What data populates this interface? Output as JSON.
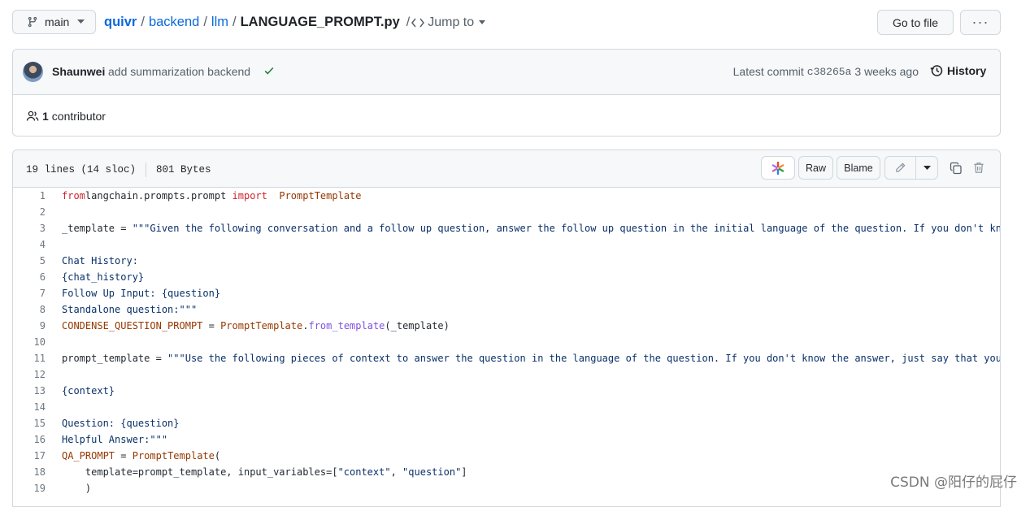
{
  "breadcrumb": {
    "branch": "main",
    "repo": "quivr",
    "dir1": "backend",
    "dir2": "llm",
    "file": "LANGUAGE_PROMPT.py",
    "jump": "Jump to"
  },
  "header_buttons": {
    "goto_file": "Go to file",
    "more": "···"
  },
  "commit": {
    "author": "Shaunwei",
    "message": "add summarization backend",
    "latest_label": "Latest commit",
    "sha": "c38265a",
    "time": "3 weeks ago",
    "history_label": "History",
    "contributors_count": "1",
    "contributors_label": "contributor"
  },
  "file_info": {
    "lines": "19 lines (14 sloc)",
    "size": "801 Bytes"
  },
  "file_actions": {
    "raw": "Raw",
    "blame": "Blame"
  },
  "code_lines": [
    {
      "n": "1",
      "parts": [
        [
          "kw",
          "from"
        ],
        [
          "",
          "langchain.prompts.prompt "
        ],
        [
          "kw",
          "import"
        ],
        [
          "",
          "  "
        ],
        [
          "cls",
          "PromptTemplate"
        ]
      ]
    },
    {
      "n": "2",
      "parts": []
    },
    {
      "n": "3",
      "parts": [
        [
          "",
          "_template = "
        ],
        [
          "str",
          "\"\"\"Given the following conversation and a follow up question, answer the follow up question in the initial language of the question. If you don't kn"
        ]
      ]
    },
    {
      "n": "4",
      "parts": []
    },
    {
      "n": "5",
      "parts": [
        [
          "str",
          "Chat History:"
        ]
      ]
    },
    {
      "n": "6",
      "parts": [
        [
          "str",
          "{chat_history}"
        ]
      ]
    },
    {
      "n": "7",
      "parts": [
        [
          "str",
          "Follow Up Input: {question}"
        ]
      ]
    },
    {
      "n": "8",
      "parts": [
        [
          "str",
          "Standalone question:\"\"\""
        ]
      ]
    },
    {
      "n": "9",
      "parts": [
        [
          "cls",
          "CONDENSE_QUESTION_PROMPT"
        ],
        [
          "",
          " = "
        ],
        [
          "cls",
          "PromptTemplate"
        ],
        [
          "",
          "."
        ],
        [
          "fn",
          "from_template"
        ],
        [
          "",
          "(_template)"
        ]
      ]
    },
    {
      "n": "10",
      "parts": []
    },
    {
      "n": "11",
      "parts": [
        [
          "",
          "prompt_template = "
        ],
        [
          "str",
          "\"\"\"Use the following pieces of context to answer the question in the language of the question. If you don't know the answer, just say that you"
        ]
      ]
    },
    {
      "n": "12",
      "parts": []
    },
    {
      "n": "13",
      "parts": [
        [
          "str",
          "{context}"
        ]
      ]
    },
    {
      "n": "14",
      "parts": []
    },
    {
      "n": "15",
      "parts": [
        [
          "str",
          "Question: {question}"
        ]
      ]
    },
    {
      "n": "16",
      "parts": [
        [
          "str",
          "Helpful Answer:\"\"\""
        ]
      ]
    },
    {
      "n": "17",
      "parts": [
        [
          "cls",
          "QA_PROMPT"
        ],
        [
          "",
          " = "
        ],
        [
          "cls",
          "PromptTemplate"
        ],
        [
          "",
          "("
        ]
      ]
    },
    {
      "n": "18",
      "parts": [
        [
          "",
          "    template=prompt_template, input_variables=["
        ],
        [
          "str",
          "\"context\""
        ],
        [
          "",
          ", "
        ],
        [
          "str",
          "\"question\""
        ],
        [
          "",
          "]"
        ]
      ]
    },
    {
      "n": "19",
      "parts": [
        [
          "",
          "    )"
        ]
      ]
    }
  ],
  "watermark": "CSDN @阳仔的屁仔"
}
